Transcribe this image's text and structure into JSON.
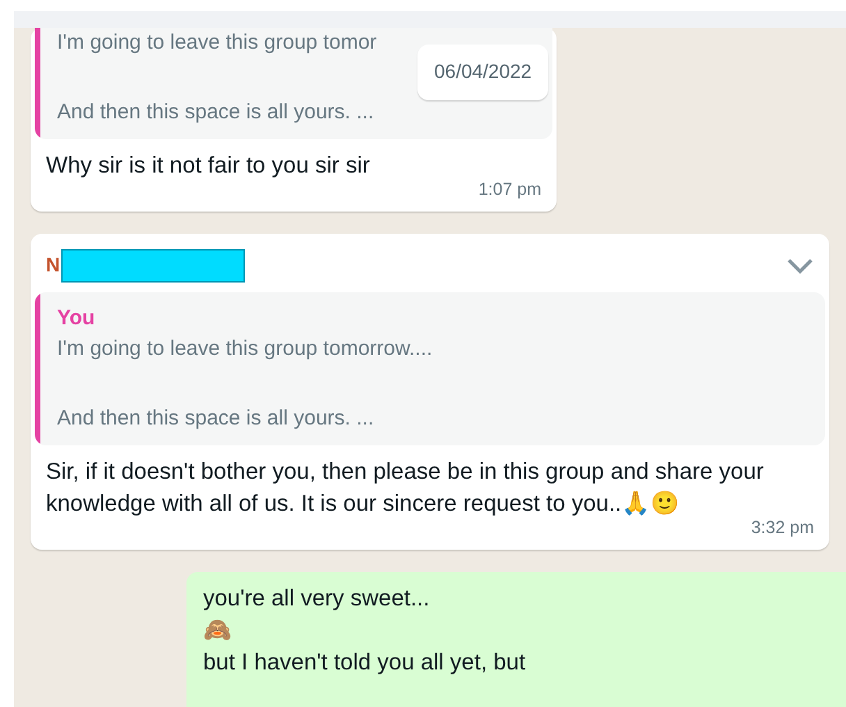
{
  "date_pill": "06/04/2022",
  "messages": [
    {
      "kind": "incoming",
      "quote": {
        "lines": [
          "I'm going to leave this group tomor",
          "And then this space is all yours. ..."
        ]
      },
      "body": [
        "Why sir is it not fair to you sir sir"
      ],
      "time": "1:07 pm"
    },
    {
      "kind": "incoming",
      "sender": "N",
      "redacted": true,
      "menu": true,
      "quote": {
        "author": "You",
        "lines": [
          "I'm going to leave this group tomorrow....",
          "And then this space is all yours. ..."
        ]
      },
      "body": [
        "Sir, if it doesn't bother you, then please be in this group and share your knowledge with all of us. It is our sincere request to you..🙏🙂"
      ],
      "time": "3:32 pm"
    },
    {
      "kind": "outgoing",
      "body": [
        "you're all very sweet...",
        "🙈",
        "but I haven't told you all yet, but"
      ]
    }
  ]
}
